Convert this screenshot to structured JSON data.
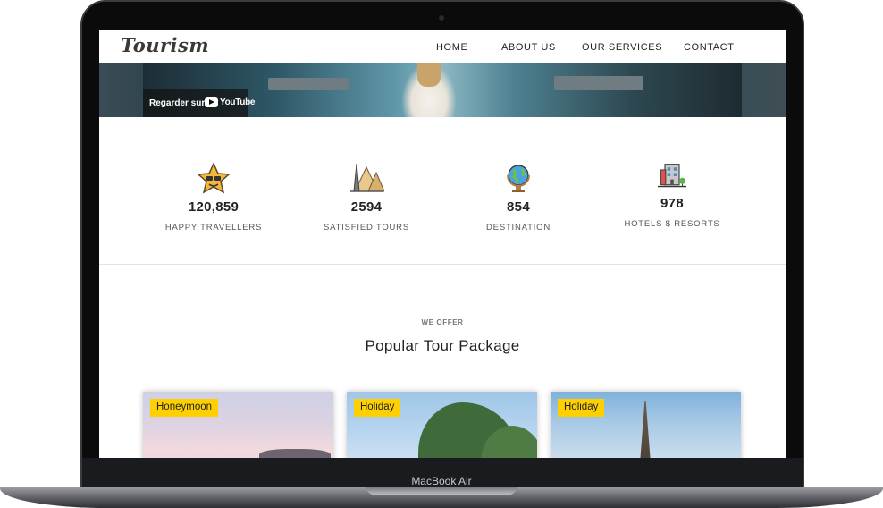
{
  "device": {
    "label": "MacBook Air"
  },
  "navbar": {
    "logo": "Tourism",
    "links": [
      "HOME",
      "ABOUT US",
      "OUR SERVICES",
      "CONTACT"
    ]
  },
  "hero": {
    "watch_label": "Regarder sur",
    "platform_label": "YouTube"
  },
  "stats": [
    {
      "icon": "star-face-icon",
      "value": "120,859",
      "label": "HAPPY TRAVELLERS"
    },
    {
      "icon": "eiffel-pyramids-icon",
      "value": "2594",
      "label": "SATISFIED TOURS"
    },
    {
      "icon": "globe-icon",
      "value": "854",
      "label": "DESTINATION"
    },
    {
      "icon": "hotel-building-icon",
      "value": "978",
      "label": "HOTELS $ RESORTS"
    }
  ],
  "offer": {
    "eyebrow": "WE OFFER",
    "title": "Popular Tour Package",
    "cards": [
      {
        "badge": "Honeymoon"
      },
      {
        "badge": "Holiday"
      },
      {
        "badge": "Holiday"
      }
    ]
  },
  "colors": {
    "badge": "#ffd000",
    "frame": "#0b0b0c",
    "text_dark": "#222222"
  }
}
